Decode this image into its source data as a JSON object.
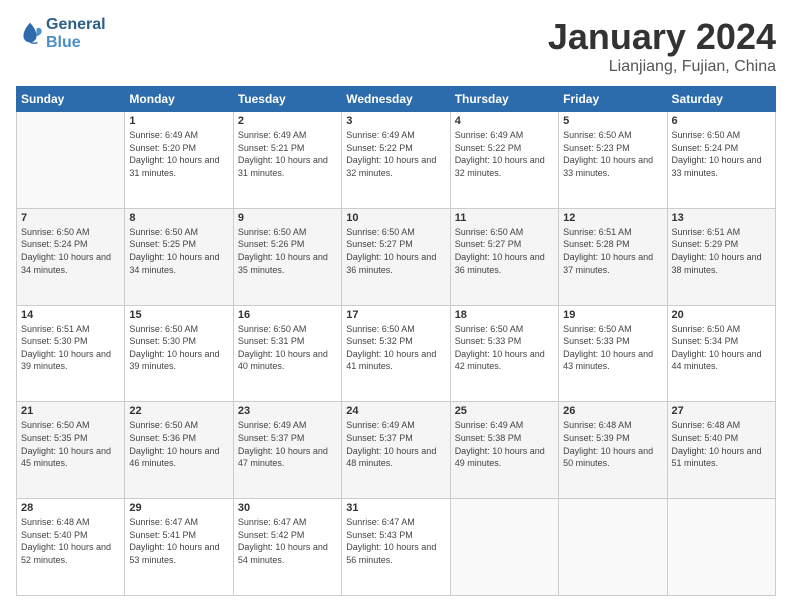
{
  "header": {
    "logo_line1": "General",
    "logo_line2": "Blue",
    "month": "January 2024",
    "location": "Lianjiang, Fujian, China"
  },
  "weekdays": [
    "Sunday",
    "Monday",
    "Tuesday",
    "Wednesday",
    "Thursday",
    "Friday",
    "Saturday"
  ],
  "weeks": [
    [
      {
        "day": "",
        "sunrise": "",
        "sunset": "",
        "daylight": ""
      },
      {
        "day": "1",
        "sunrise": "Sunrise: 6:49 AM",
        "sunset": "Sunset: 5:20 PM",
        "daylight": "Daylight: 10 hours and 31 minutes."
      },
      {
        "day": "2",
        "sunrise": "Sunrise: 6:49 AM",
        "sunset": "Sunset: 5:21 PM",
        "daylight": "Daylight: 10 hours and 31 minutes."
      },
      {
        "day": "3",
        "sunrise": "Sunrise: 6:49 AM",
        "sunset": "Sunset: 5:22 PM",
        "daylight": "Daylight: 10 hours and 32 minutes."
      },
      {
        "day": "4",
        "sunrise": "Sunrise: 6:49 AM",
        "sunset": "Sunset: 5:22 PM",
        "daylight": "Daylight: 10 hours and 32 minutes."
      },
      {
        "day": "5",
        "sunrise": "Sunrise: 6:50 AM",
        "sunset": "Sunset: 5:23 PM",
        "daylight": "Daylight: 10 hours and 33 minutes."
      },
      {
        "day": "6",
        "sunrise": "Sunrise: 6:50 AM",
        "sunset": "Sunset: 5:24 PM",
        "daylight": "Daylight: 10 hours and 33 minutes."
      }
    ],
    [
      {
        "day": "7",
        "sunrise": "Sunrise: 6:50 AM",
        "sunset": "Sunset: 5:24 PM",
        "daylight": "Daylight: 10 hours and 34 minutes."
      },
      {
        "day": "8",
        "sunrise": "Sunrise: 6:50 AM",
        "sunset": "Sunset: 5:25 PM",
        "daylight": "Daylight: 10 hours and 34 minutes."
      },
      {
        "day": "9",
        "sunrise": "Sunrise: 6:50 AM",
        "sunset": "Sunset: 5:26 PM",
        "daylight": "Daylight: 10 hours and 35 minutes."
      },
      {
        "day": "10",
        "sunrise": "Sunrise: 6:50 AM",
        "sunset": "Sunset: 5:27 PM",
        "daylight": "Daylight: 10 hours and 36 minutes."
      },
      {
        "day": "11",
        "sunrise": "Sunrise: 6:50 AM",
        "sunset": "Sunset: 5:27 PM",
        "daylight": "Daylight: 10 hours and 36 minutes."
      },
      {
        "day": "12",
        "sunrise": "Sunrise: 6:51 AM",
        "sunset": "Sunset: 5:28 PM",
        "daylight": "Daylight: 10 hours and 37 minutes."
      },
      {
        "day": "13",
        "sunrise": "Sunrise: 6:51 AM",
        "sunset": "Sunset: 5:29 PM",
        "daylight": "Daylight: 10 hours and 38 minutes."
      }
    ],
    [
      {
        "day": "14",
        "sunrise": "Sunrise: 6:51 AM",
        "sunset": "Sunset: 5:30 PM",
        "daylight": "Daylight: 10 hours and 39 minutes."
      },
      {
        "day": "15",
        "sunrise": "Sunrise: 6:50 AM",
        "sunset": "Sunset: 5:30 PM",
        "daylight": "Daylight: 10 hours and 39 minutes."
      },
      {
        "day": "16",
        "sunrise": "Sunrise: 6:50 AM",
        "sunset": "Sunset: 5:31 PM",
        "daylight": "Daylight: 10 hours and 40 minutes."
      },
      {
        "day": "17",
        "sunrise": "Sunrise: 6:50 AM",
        "sunset": "Sunset: 5:32 PM",
        "daylight": "Daylight: 10 hours and 41 minutes."
      },
      {
        "day": "18",
        "sunrise": "Sunrise: 6:50 AM",
        "sunset": "Sunset: 5:33 PM",
        "daylight": "Daylight: 10 hours and 42 minutes."
      },
      {
        "day": "19",
        "sunrise": "Sunrise: 6:50 AM",
        "sunset": "Sunset: 5:33 PM",
        "daylight": "Daylight: 10 hours and 43 minutes."
      },
      {
        "day": "20",
        "sunrise": "Sunrise: 6:50 AM",
        "sunset": "Sunset: 5:34 PM",
        "daylight": "Daylight: 10 hours and 44 minutes."
      }
    ],
    [
      {
        "day": "21",
        "sunrise": "Sunrise: 6:50 AM",
        "sunset": "Sunset: 5:35 PM",
        "daylight": "Daylight: 10 hours and 45 minutes."
      },
      {
        "day": "22",
        "sunrise": "Sunrise: 6:50 AM",
        "sunset": "Sunset: 5:36 PM",
        "daylight": "Daylight: 10 hours and 46 minutes."
      },
      {
        "day": "23",
        "sunrise": "Sunrise: 6:49 AM",
        "sunset": "Sunset: 5:37 PM",
        "daylight": "Daylight: 10 hours and 47 minutes."
      },
      {
        "day": "24",
        "sunrise": "Sunrise: 6:49 AM",
        "sunset": "Sunset: 5:37 PM",
        "daylight": "Daylight: 10 hours and 48 minutes."
      },
      {
        "day": "25",
        "sunrise": "Sunrise: 6:49 AM",
        "sunset": "Sunset: 5:38 PM",
        "daylight": "Daylight: 10 hours and 49 minutes."
      },
      {
        "day": "26",
        "sunrise": "Sunrise: 6:48 AM",
        "sunset": "Sunset: 5:39 PM",
        "daylight": "Daylight: 10 hours and 50 minutes."
      },
      {
        "day": "27",
        "sunrise": "Sunrise: 6:48 AM",
        "sunset": "Sunset: 5:40 PM",
        "daylight": "Daylight: 10 hours and 51 minutes."
      }
    ],
    [
      {
        "day": "28",
        "sunrise": "Sunrise: 6:48 AM",
        "sunset": "Sunset: 5:40 PM",
        "daylight": "Daylight: 10 hours and 52 minutes."
      },
      {
        "day": "29",
        "sunrise": "Sunrise: 6:47 AM",
        "sunset": "Sunset: 5:41 PM",
        "daylight": "Daylight: 10 hours and 53 minutes."
      },
      {
        "day": "30",
        "sunrise": "Sunrise: 6:47 AM",
        "sunset": "Sunset: 5:42 PM",
        "daylight": "Daylight: 10 hours and 54 minutes."
      },
      {
        "day": "31",
        "sunrise": "Sunrise: 6:47 AM",
        "sunset": "Sunset: 5:43 PM",
        "daylight": "Daylight: 10 hours and 56 minutes."
      },
      {
        "day": "",
        "sunrise": "",
        "sunset": "",
        "daylight": ""
      },
      {
        "day": "",
        "sunrise": "",
        "sunset": "",
        "daylight": ""
      },
      {
        "day": "",
        "sunrise": "",
        "sunset": "",
        "daylight": ""
      }
    ]
  ]
}
